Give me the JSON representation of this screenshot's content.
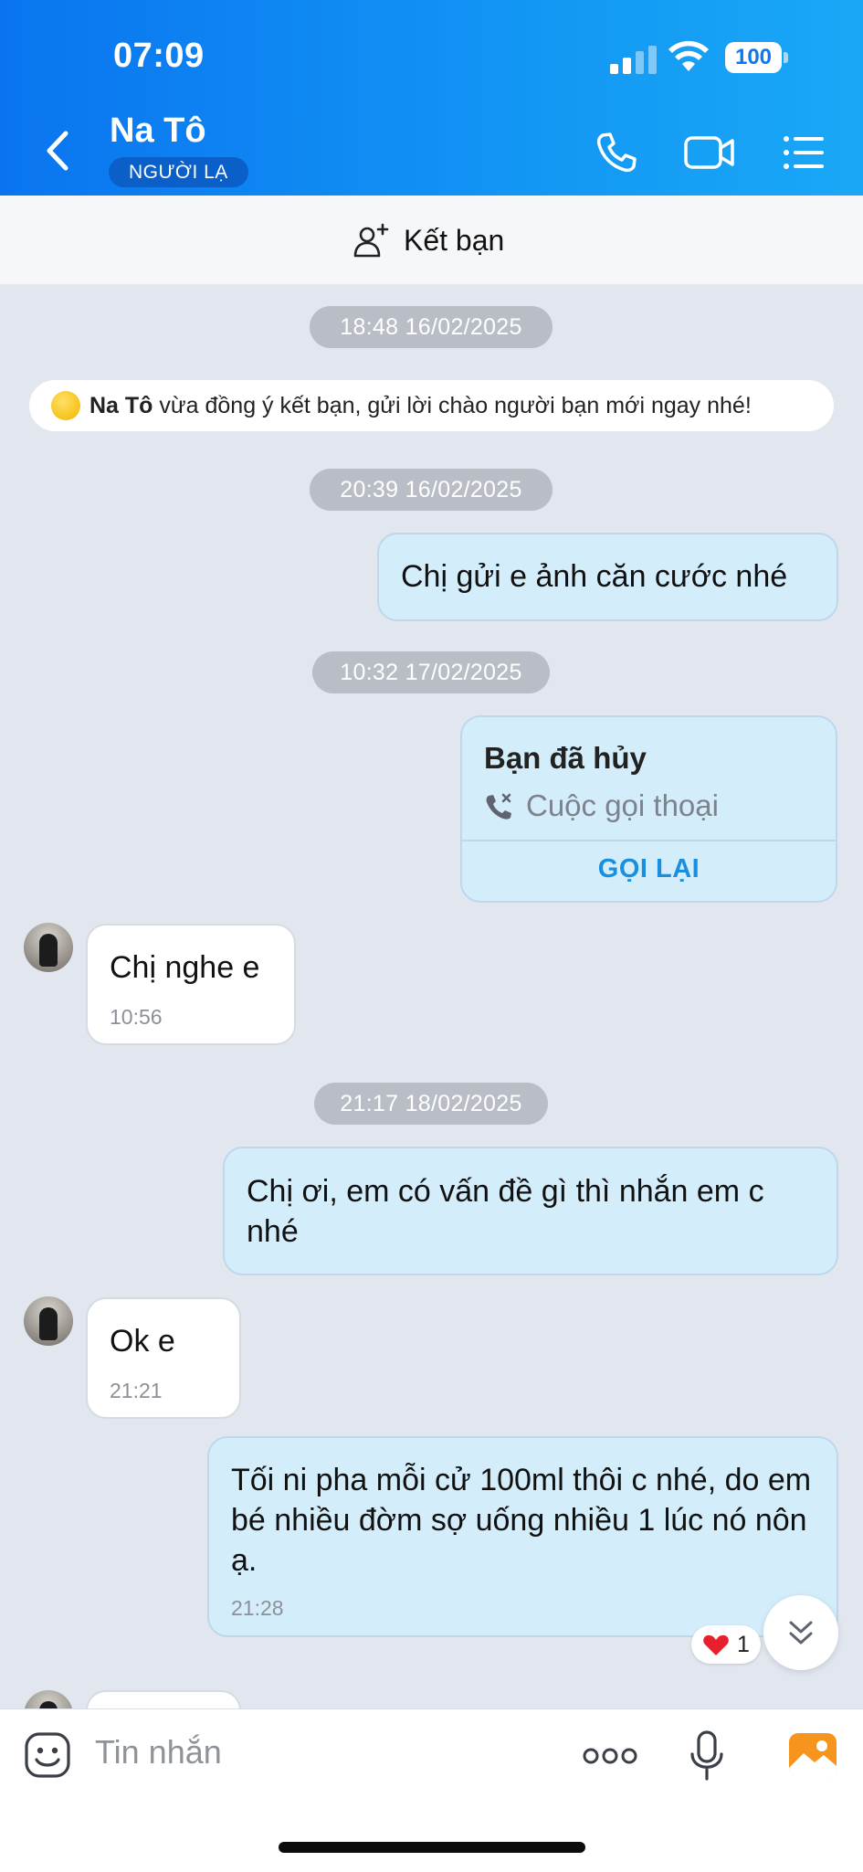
{
  "status_bar": {
    "time": "07:09",
    "battery": "100"
  },
  "header": {
    "name": "Na Tô",
    "badge": "NGƯỜI LẠ"
  },
  "add_friend": {
    "label": "Kết bạn"
  },
  "system_message": {
    "name": "Na Tô",
    "text": " vừa đồng ý kết bạn, gửi lời chào người bạn mới ngay nhé!"
  },
  "timestamps": [
    "18:48 16/02/2025",
    "20:39 16/02/2025",
    "10:32 17/02/2025",
    "21:17 18/02/2025"
  ],
  "messages": [
    {
      "direction": "out",
      "text": "Chị gửi e ảnh căn cước nhé"
    },
    {
      "direction": "in",
      "text": "Chị nghe e",
      "time": "10:56"
    },
    {
      "direction": "out",
      "text": "Chị ơi, em có vấn đề gì thì nhắn em c nhé"
    },
    {
      "direction": "in",
      "text": "Ok e",
      "time": "21:21"
    },
    {
      "direction": "out",
      "text": "Tối ni pha mỗi cử 100ml thôi c nhé, do em bé nhiều đờm sợ uống nhiều 1 lúc nó nôn ạ.",
      "time": "21:28"
    }
  ],
  "call_card": {
    "title": "Bạn đã hủy",
    "type": "Cuộc gọi thoại",
    "action": "GỌI LẠI"
  },
  "reaction": {
    "count": "1"
  },
  "input": {
    "placeholder": "Tin nhắn"
  },
  "colors": {
    "header_blue": "#0a74f0",
    "bubble_out": "#d4edfb",
    "chat_bg": "#e2e6ef",
    "link_blue": "#1a8fe0"
  },
  "icons": [
    "back-icon",
    "phone-icon",
    "video-icon",
    "menu-icon",
    "add-friend-icon",
    "missed-call-icon",
    "heart-icon",
    "chevron-double-down-icon",
    "sticker-icon",
    "more-icon",
    "microphone-icon",
    "image-icon"
  ]
}
